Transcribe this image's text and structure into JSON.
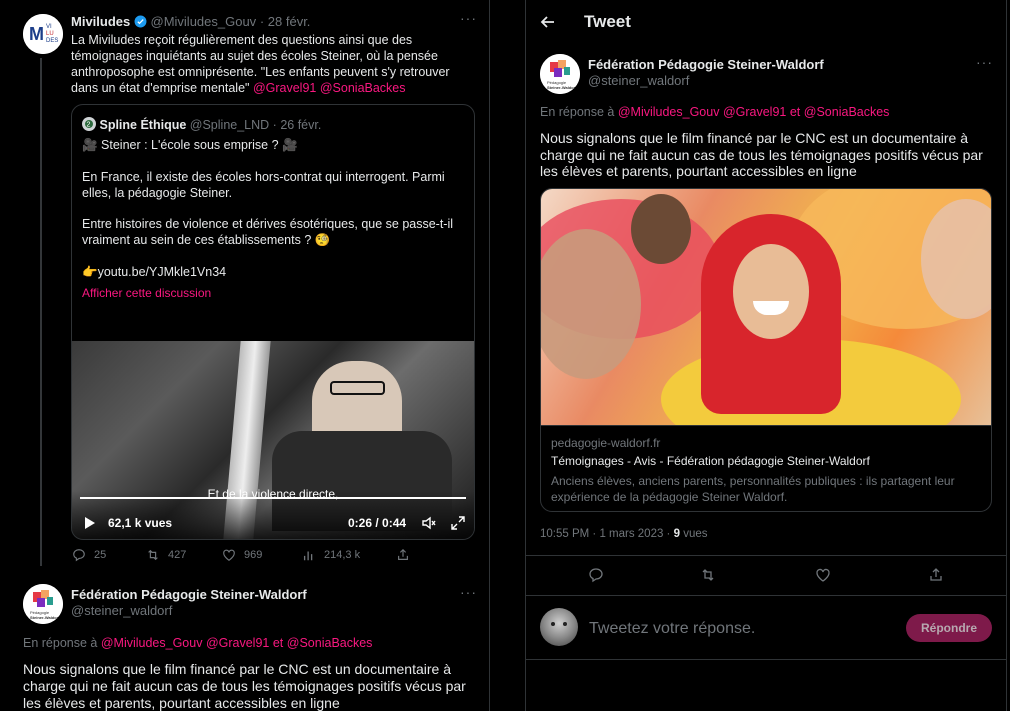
{
  "left": {
    "tweet1": {
      "name": "Miviludes",
      "handle": "@Miviludes_Gouv",
      "dot": "·",
      "date": "28 févr.",
      "text_line1": "La Miviludes reçoit régulièrement des questions ainsi que des",
      "text_line2": "témoignages inquiétants au sujet des écoles Steiner, où la pensée",
      "text_line3": "anthroposophe est omniprésente. \"Les enfants peuvent s'y retrouver",
      "text_line4": "dans un état d'emprise mentale\"",
      "mention1": "@Gravel91",
      "mention2": "@SoniaBackes",
      "avatar_text": "MI VI LU DES",
      "quote": {
        "name": "Spline Éthique",
        "handle": "@Spline_LND",
        "dot": "·",
        "date": "26 févr.",
        "line1": "🎥 Steiner : L'école sous emprise ? 🎥",
        "line2": "En France, il existe des écoles hors-contrat qui interrogent. Parmi",
        "line3": "elles, la pédagogie Steiner.",
        "line4": "Entre histoires de violence et dérives ésotériques, que se passe-t-il",
        "line5": "vraiment au sein de ces établissements ? 🧐",
        "link": "👉youtu.be/YJMkle1Vn34",
        "show_thread": "Afficher cette discussion",
        "subtitle": "Et de la violence directe,",
        "views": "62,1 k vues",
        "time": "0:26 / 0:44"
      },
      "stats": {
        "replies": "25",
        "retweets": "427",
        "likes": "969",
        "views": "214,3 k"
      }
    },
    "tweet2": {
      "name": "Fédération Pédagogie Steiner-Waldorf",
      "handle": "@steiner_waldorf",
      "reply_prefix": "En réponse à",
      "reply_to1": "@Miviludes_Gouv",
      "reply_to2": "@Gravel91",
      "reply_and": "et",
      "reply_to3": "@SoniaBackes",
      "line1": "Nous signalons que le film financé par le CNC est un documentaire à",
      "line2": "charge qui ne fait aucun cas de tous les témoignages positifs vécus par",
      "line3": "les élèves et parents, pourtant accessibles en ligne"
    }
  },
  "right": {
    "header_title": "Tweet",
    "tweet": {
      "name": "Fédération Pédagogie Steiner-Waldorf",
      "handle": "@steiner_waldorf",
      "reply_prefix": "En réponse à",
      "reply_to1": "@Miviludes_Gouv",
      "reply_to2": "@Gravel91",
      "reply_and": "et",
      "reply_to3": "@SoniaBackes",
      "line1": "Nous signalons que le film financé par le CNC est un documentaire à",
      "line2": "charge qui ne fait aucun cas de tous les témoignages positifs vécus par",
      "line3": "les élèves et parents, pourtant accessibles en ligne",
      "card": {
        "domain": "pedagogie-waldorf.fr",
        "title": "Témoignages - Avis - Fédération pédagogie Steiner-Waldorf",
        "desc1": "Anciens élèves, anciens parents, personnalités publiques : ils partagent leur",
        "desc2": "expérience de la pédagogie Steiner Waldorf."
      },
      "timestamp": "10:55 PM · 1 mars 2023 ·",
      "views_count": "9",
      "views_label": "vues"
    },
    "reply_placeholder": "Tweetez votre réponse.",
    "reply_button": "Répondre"
  },
  "colors": {
    "background": "#000000",
    "text": "#e7e9ea",
    "muted": "#71767b",
    "accent_pink": "#f91880",
    "border": "#2f3336",
    "verified": "#1d9bf0"
  }
}
